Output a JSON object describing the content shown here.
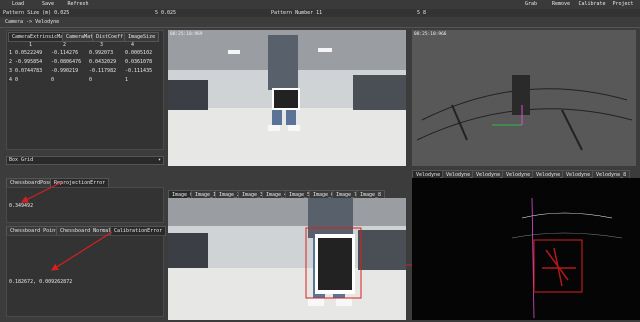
{
  "toolbar": {
    "load": "Load",
    "save": "Save",
    "refresh": "Refresh",
    "grab": "Grab",
    "remove": "Remove",
    "calibrate": "Calibrate",
    "project": "Project"
  },
  "params": {
    "pattern_size_label": "Pattern Size (m) 0.025",
    "pattern_size_value": "5  0.025",
    "pattern_number_label": "Pattern Number  11",
    "pattern_number_value": "5  8"
  },
  "camera_mode": "Camera -> Velodyne",
  "matrix_table": {
    "headers": [
      "CameraExtrinsicMat",
      "CameraMat",
      "DistCoeff",
      "ImageSize"
    ],
    "col_index": [
      "1",
      "2",
      "3",
      "4"
    ],
    "rows": [
      [
        "1  0.0522249",
        "-0.114276",
        "0.992073",
        "0.0005102"
      ],
      [
        "2  -0.995854",
        "-0.0806476",
        "0.0432029",
        "0.0361078"
      ],
      [
        "3  0.0744783",
        "-0.990219",
        "-0.117982",
        "-0.111435"
      ],
      [
        "4  0",
        "0",
        "0",
        "1"
      ]
    ]
  },
  "grid_select": "Box Grid",
  "tabs_top": {
    "a": "ChessboardPose",
    "b": "ReprojectionError",
    "value": "0.349492"
  },
  "tabs_bottom": {
    "a": "Chessboard Points",
    "b": "Chessboard Normals",
    "c": "CalibrationError",
    "value": "0.182672, 0.009262872"
  },
  "image_top": {
    "timestamp": "08:25:10:969"
  },
  "cloud_top": {
    "timestamp": "08:25:10:966"
  },
  "image_tabs": [
    "Image_0",
    "Image_1",
    "Image_2",
    "Image_3",
    "Image_4",
    "Image_5",
    "Image_6",
    "Image_7",
    "Image_8"
  ],
  "velodyne_tabs": [
    "Velodyne_2",
    "Velodyne_3",
    "Velodyne_4",
    "Velodyne_5",
    "Velodyne_6",
    "Velodyne_7",
    "Velodyne_8"
  ],
  "colors": {
    "accent_red": "#d62020",
    "bg": "#3c3c3c"
  }
}
